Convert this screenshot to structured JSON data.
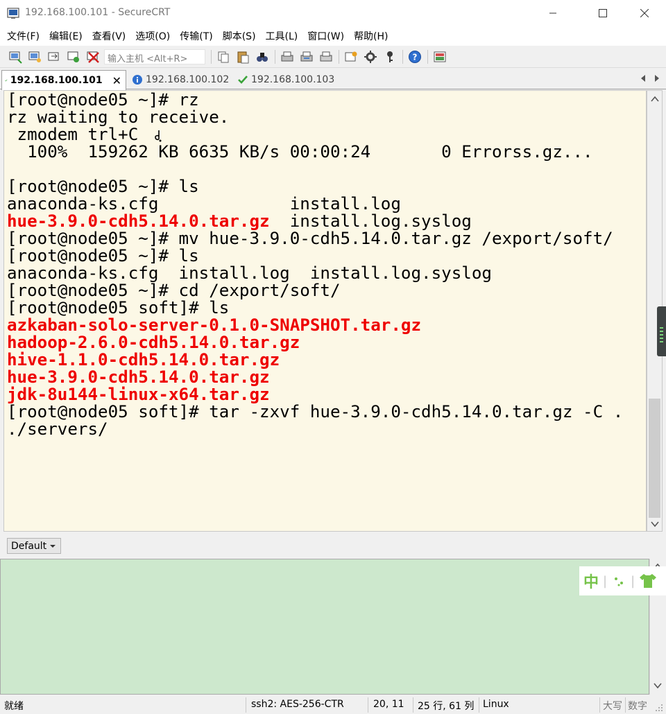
{
  "window": {
    "title": "192.168.100.101 - SecureCRT"
  },
  "menu": [
    "文件(F)",
    "编辑(E)",
    "查看(V)",
    "选项(O)",
    "传输(T)",
    "脚本(S)",
    "工具(L)",
    "窗口(W)",
    "帮助(H)"
  ],
  "toolbar": {
    "host_placeholder": "输入主机 <Alt+R>"
  },
  "tabs": [
    {
      "label": "192.168.100.101",
      "state": "connected",
      "active": true
    },
    {
      "label": "192.168.100.102",
      "state": "info",
      "active": false
    },
    {
      "label": "192.168.100.103",
      "state": "connected",
      "active": false
    }
  ],
  "terminal": {
    "lines": [
      {
        "text": "[root@node05 ~]# rz",
        "color": "default"
      },
      {
        "text": "rz waiting to receive.",
        "color": "default"
      },
      {
        "text": " zmodem trl+C",
        "color": "default"
      },
      {
        "text": "  100%  159262 KB 6635 KB/s 00:00:24       0 Errorss.gz...",
        "color": "default"
      },
      {
        "text": "",
        "color": "default"
      },
      {
        "text": "[root@node05 ~]# ls",
        "color": "default"
      },
      {
        "text": "anaconda-ks.cfg             install.log",
        "color": "default"
      },
      {
        "text": "hue-3.9.0-cdh5.14.0.tar.gz",
        "color": "red",
        "suffix": "  install.log.syslog"
      },
      {
        "text": "[root@node05 ~]# mv hue-3.9.0-cdh5.14.0.tar.gz /export/soft/",
        "color": "default"
      },
      {
        "text": "[root@node05 ~]# ls",
        "color": "default"
      },
      {
        "text": "anaconda-ks.cfg  install.log  install.log.syslog",
        "color": "default"
      },
      {
        "text": "[root@node05 ~]# cd /export/soft/",
        "color": "default"
      },
      {
        "text": "[root@node05 soft]# ls",
        "color": "default"
      },
      {
        "text": "azkaban-solo-server-0.1.0-SNAPSHOT.tar.gz",
        "color": "red"
      },
      {
        "text": "hadoop-2.6.0-cdh5.14.0.tar.gz",
        "color": "red"
      },
      {
        "text": "hive-1.1.0-cdh5.14.0.tar.gz",
        "color": "red"
      },
      {
        "text": "hue-3.9.0-cdh5.14.0.tar.gz",
        "color": "red"
      },
      {
        "text": "jdk-8u144-linux-x64.tar.gz",
        "color": "red"
      },
      {
        "text": "[root@node05 soft]# tar -zxvf hue-3.9.0-cdh5.14.0.tar.gz -C .",
        "color": "default"
      },
      {
        "text": "./servers/",
        "color": "default"
      }
    ],
    "colors": {
      "background": "#fcf8e6",
      "text": "#000000",
      "archive": "#ee0000"
    }
  },
  "session_select": {
    "value": "Default"
  },
  "command_window": {
    "background": "#cde8cd"
  },
  "ime": {
    "mode_char": "中",
    "separator": "|"
  },
  "status": {
    "ready": "就绪",
    "protocol": "ssh2: AES-256-CTR",
    "cursor": "20,  11",
    "size": "25 行, 61 列",
    "os": "Linux",
    "caps": "大写",
    "num": "数字"
  }
}
